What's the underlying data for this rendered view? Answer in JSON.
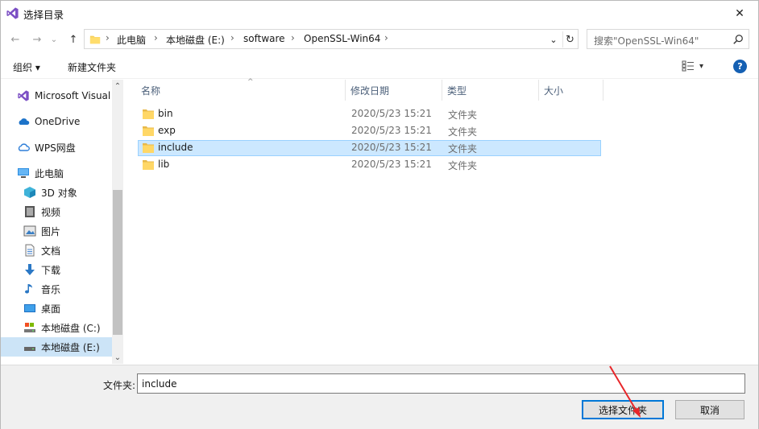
{
  "window": {
    "title": "选择目录",
    "close_symbol": "✕"
  },
  "nav": {
    "back": "←",
    "forward": "→",
    "recent": "⌄",
    "up": "↑"
  },
  "address": {
    "crumbs": [
      "此电脑",
      "本地磁盘 (E:)",
      "software",
      "OpenSSL-Win64"
    ],
    "separator": "›",
    "dropdown": "⌄",
    "refresh": "↻"
  },
  "search": {
    "placeholder": "搜索\"OpenSSL-Win64\""
  },
  "toolbar": {
    "organize": "组织 ▾",
    "new_folder": "新建文件夹",
    "view_arrow": "▾",
    "help": "?"
  },
  "sidebar": {
    "items": [
      {
        "label": "Microsoft Visual",
        "icon": "visual-studio-icon"
      },
      {
        "label": "OneDrive",
        "icon": "onedrive-icon"
      },
      {
        "label": "WPS网盘",
        "icon": "wps-cloud-icon"
      },
      {
        "label": "此电脑",
        "icon": "this-pc-icon"
      },
      {
        "label": "3D 对象",
        "icon": "3d-objects-icon"
      },
      {
        "label": "视频",
        "icon": "videos-icon"
      },
      {
        "label": "图片",
        "icon": "pictures-icon"
      },
      {
        "label": "文档",
        "icon": "documents-icon"
      },
      {
        "label": "下载",
        "icon": "downloads-icon"
      },
      {
        "label": "音乐",
        "icon": "music-icon"
      },
      {
        "label": "桌面",
        "icon": "desktop-icon"
      },
      {
        "label": "本地磁盘 (C:)",
        "icon": "drive-c-icon"
      },
      {
        "label": "本地磁盘 (E:)",
        "icon": "drive-e-icon",
        "selected": true
      }
    ],
    "scroll_up": "⌃",
    "scroll_down": "⌄"
  },
  "filelist": {
    "columns": {
      "name": "名称",
      "modified": "修改日期",
      "type": "类型",
      "size": "大小"
    },
    "sort_indicator": "^",
    "rows": [
      {
        "name": "bin",
        "modified": "2020/5/23 15:21",
        "type": "文件夹"
      },
      {
        "name": "exp",
        "modified": "2020/5/23 15:21",
        "type": "文件夹"
      },
      {
        "name": "include",
        "modified": "2020/5/23 15:21",
        "type": "文件夹",
        "selected": true
      },
      {
        "name": "lib",
        "modified": "2020/5/23 15:21",
        "type": "文件夹"
      }
    ]
  },
  "bottom": {
    "folder_label": "文件夹:",
    "folder_value": "include",
    "select_button": "选择文件夹",
    "cancel_button": "取消"
  },
  "colors": {
    "accent": "#0078d7",
    "selected_row": "#cce8ff",
    "annotation_arrow": "#e8262a"
  }
}
